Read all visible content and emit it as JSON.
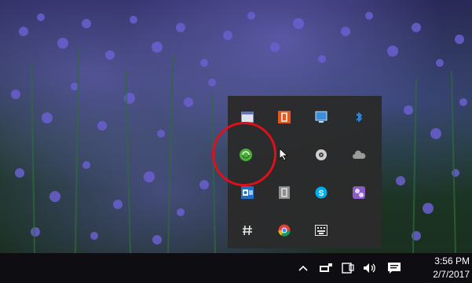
{
  "tray": {
    "icons": [
      "window-icon",
      "office-icon",
      "monitor-icon",
      "bluetooth-icon",
      "sync-icon",
      "cursor-icon",
      "disc-icon",
      "cloud-icon",
      "outlook-icon",
      "document-icon",
      "skype-icon",
      "settings-icon",
      "hash-icon",
      "chrome-icon",
      "keyboard-icon"
    ],
    "highlighted_icon": "sync-icon"
  },
  "taskbar": {
    "show_hidden_icon": "chevron-up-icon",
    "clock_time": "3:56 PM",
    "clock_date": "2/7/2017"
  },
  "colors": {
    "highlight": "#e0101a",
    "flyout_bg": "#2b2b2b",
    "taskbar_bg": "#0e0e12"
  }
}
